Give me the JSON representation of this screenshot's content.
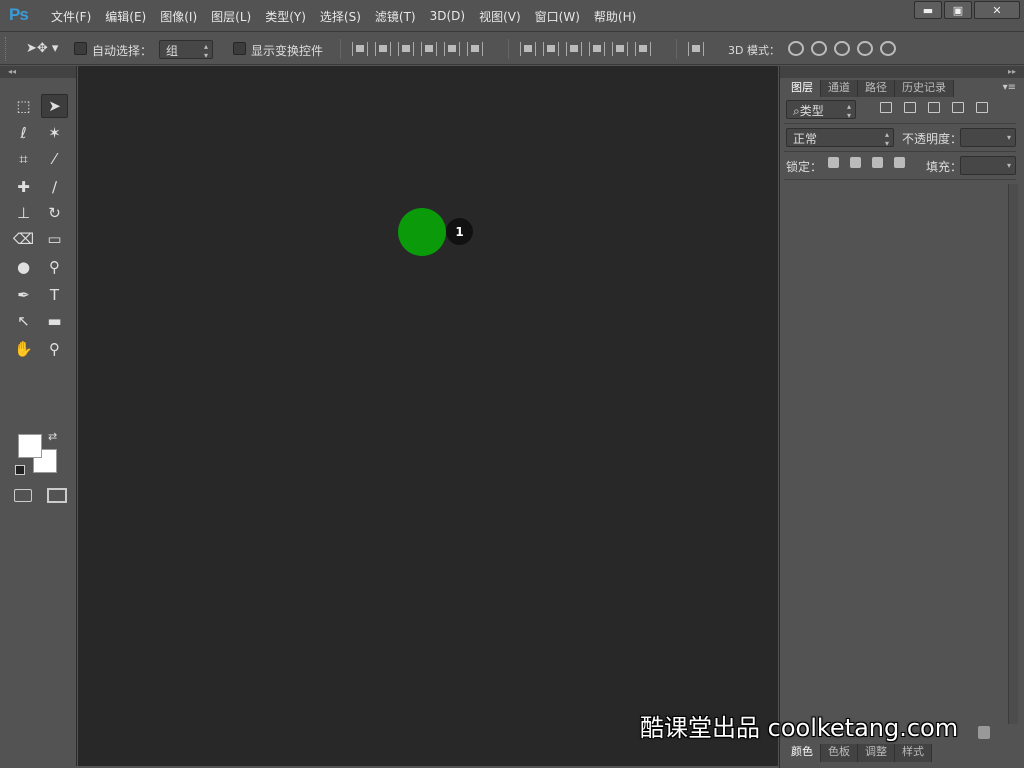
{
  "app": {
    "logo": "Ps"
  },
  "menu": [
    "文件(F)",
    "编辑(E)",
    "图像(I)",
    "图层(L)",
    "类型(Y)",
    "选择(S)",
    "滤镜(T)",
    "3D(D)",
    "视图(V)",
    "窗口(W)",
    "帮助(H)"
  ],
  "window_buttons": {
    "minimize": "▬",
    "maximize": "▣",
    "close": "✕"
  },
  "options": {
    "tool_icon": "move-tool",
    "auto_select_label": "自动选择：",
    "auto_select_value": "组",
    "show_transform_label": "显示变换控件",
    "mode_3d_label": "3D 模式："
  },
  "toolbox": {
    "collapse": "◂◂",
    "tools": [
      {
        "name": "marquee",
        "glyph": "⬚"
      },
      {
        "name": "move",
        "glyph": "➤"
      },
      {
        "name": "lasso",
        "glyph": "ℓ"
      },
      {
        "name": "magic-wand",
        "glyph": "✶"
      },
      {
        "name": "crop",
        "glyph": "⌗"
      },
      {
        "name": "eyedropper",
        "glyph": "⁄"
      },
      {
        "name": "healing",
        "glyph": "✚"
      },
      {
        "name": "brush",
        "glyph": "∕"
      },
      {
        "name": "stamp",
        "glyph": "⊥"
      },
      {
        "name": "history-brush",
        "glyph": "↻"
      },
      {
        "name": "eraser",
        "glyph": "⌫"
      },
      {
        "name": "gradient",
        "glyph": "▭"
      },
      {
        "name": "blur",
        "glyph": "●"
      },
      {
        "name": "dodge",
        "glyph": "⚲"
      },
      {
        "name": "pen",
        "glyph": "✒"
      },
      {
        "name": "type",
        "glyph": "T"
      },
      {
        "name": "path-select",
        "glyph": "↖"
      },
      {
        "name": "rectangle",
        "glyph": "▬"
      },
      {
        "name": "hand",
        "glyph": "✋"
      },
      {
        "name": "zoom",
        "glyph": "⚲"
      }
    ]
  },
  "canvas": {
    "badge": "1",
    "dot_color": "#0a9a0a"
  },
  "panel": {
    "header": "▸▸",
    "tabs": [
      "图层",
      "通道",
      "路径",
      "历史记录"
    ],
    "filter_label": "⌕类型",
    "blend_mode": "正常",
    "opacity_label": "不透明度：",
    "lock_label": "锁定：",
    "fill_label": "填充：",
    "bottom_tabs": [
      "颜色",
      "色板",
      "调整",
      "样式"
    ]
  },
  "watermark": "酷课堂出品 coolketang.com"
}
